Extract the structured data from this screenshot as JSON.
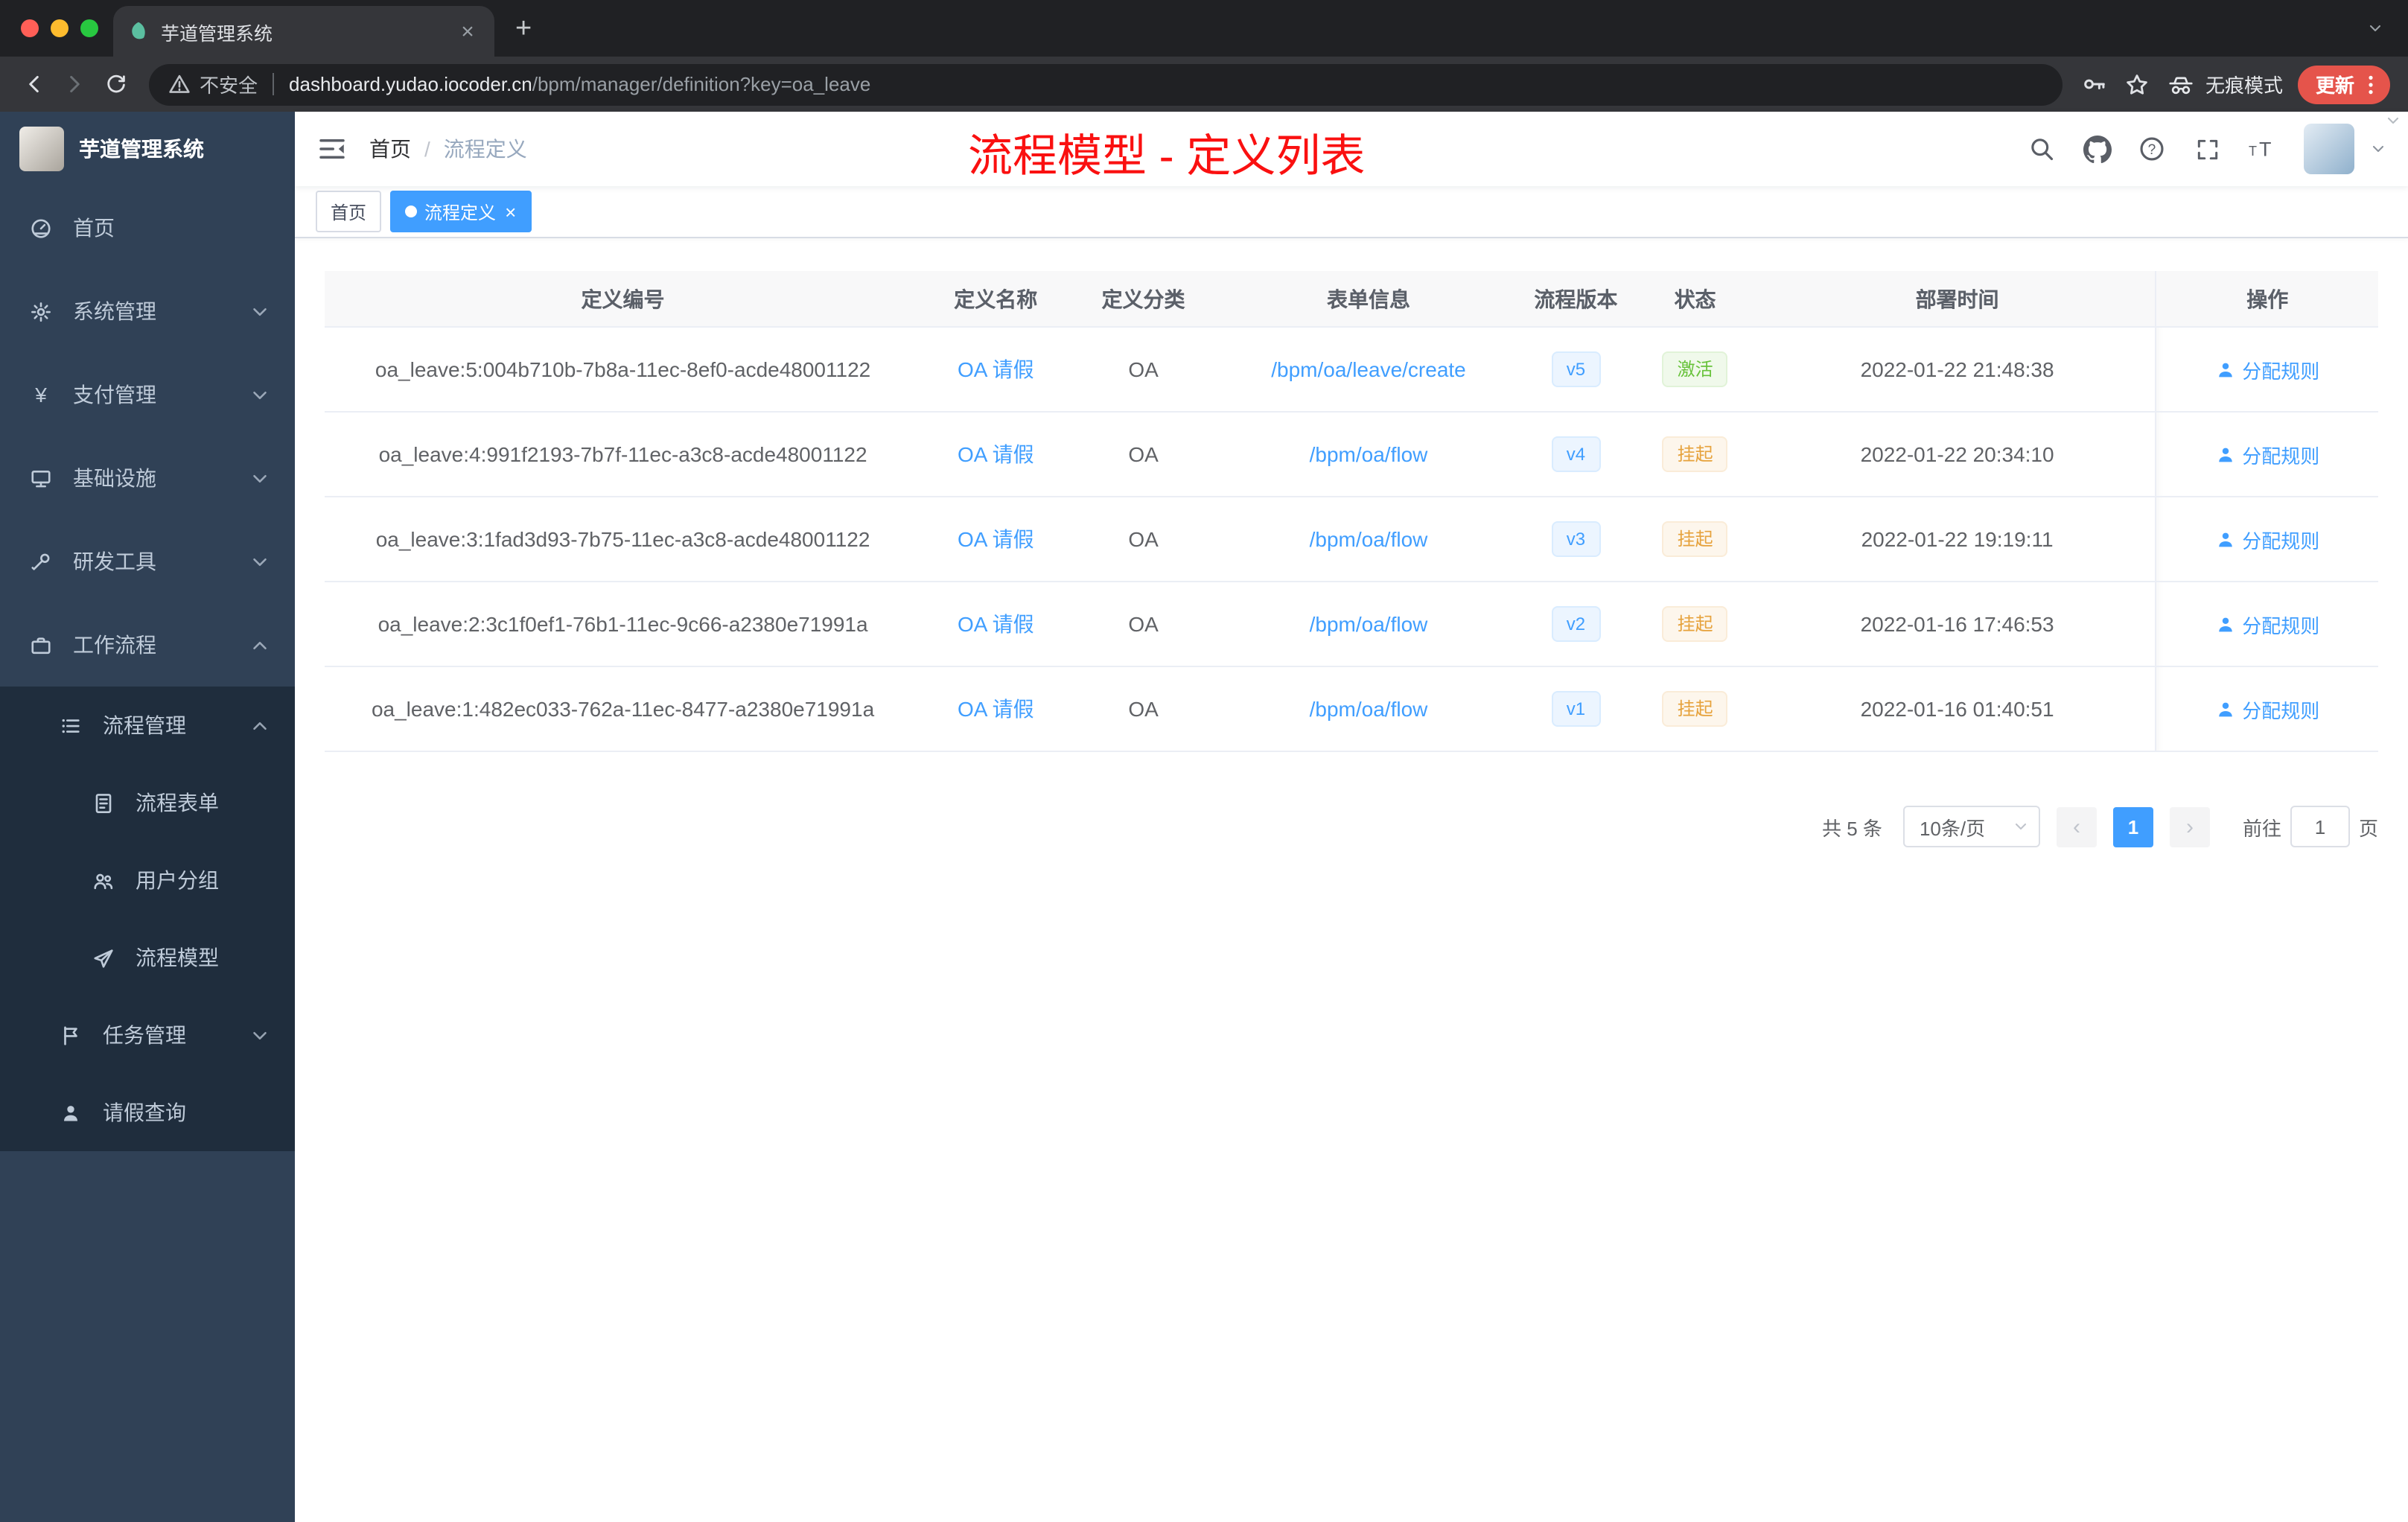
{
  "browser": {
    "tab_title": "芋道管理系统",
    "security_label": "不安全",
    "url_host": "dashboard.yudao.iocoder.cn",
    "url_path": "/bpm/manager/definition?key=oa_leave",
    "incognito_label": "无痕模式",
    "update_label": "更新"
  },
  "glyphs": {
    "close": "×",
    "plus": "+",
    "yen": "¥",
    "question": "?",
    "prev": "‹",
    "next": "›",
    "font_small": "T",
    "font_large": "T"
  },
  "sidebar": {
    "logo_title": "芋道管理系统",
    "menu": {
      "home": "首页",
      "system": "系统管理",
      "payment": "支付管理",
      "infrastructure": "基础设施",
      "devtools": "研发工具",
      "workflow": "工作流程",
      "process_mgmt": "流程管理",
      "process_form": "流程表单",
      "user_group": "用户分组",
      "process_model": "流程模型",
      "task_mgmt": "任务管理",
      "leave_query": "请假查询"
    }
  },
  "header": {
    "breadcrumb_home": "首页",
    "breadcrumb_sep": "/",
    "breadcrumb_current": "流程定义",
    "annotation": "流程模型 - 定义列表"
  },
  "tags": {
    "home": "首页",
    "active": "流程定义"
  },
  "table": {
    "columns": {
      "id": "定义编号",
      "name": "定义名称",
      "category": "定义分类",
      "form": "表单信息",
      "version": "流程版本",
      "status": "状态",
      "time": "部署时间",
      "ops": "操作"
    },
    "op_label": "分配规则",
    "rows": [
      {
        "id": "oa_leave:5:004b710b-7b8a-11ec-8ef0-acde48001122",
        "name": "OA 请假",
        "category": "OA",
        "form": "/bpm/oa/leave/create",
        "version": "v5",
        "status": "激活",
        "time": "2022-01-22 21:48:38"
      },
      {
        "id": "oa_leave:4:991f2193-7b7f-11ec-a3c8-acde48001122",
        "name": "OA 请假",
        "category": "OA",
        "form": "/bpm/oa/flow",
        "version": "v4",
        "status": "挂起",
        "time": "2022-01-22 20:34:10"
      },
      {
        "id": "oa_leave:3:1fad3d93-7b75-11ec-a3c8-acde48001122",
        "name": "OA 请假",
        "category": "OA",
        "form": "/bpm/oa/flow",
        "version": "v3",
        "status": "挂起",
        "time": "2022-01-22 19:19:11"
      },
      {
        "id": "oa_leave:2:3c1f0ef1-76b1-11ec-9c66-a2380e71991a",
        "name": "OA 请假",
        "category": "OA",
        "form": "/bpm/oa/flow",
        "version": "v2",
        "status": "挂起",
        "time": "2022-01-16 17:46:53"
      },
      {
        "id": "oa_leave:1:482ec033-762a-11ec-8477-a2380e71991a",
        "name": "OA 请假",
        "category": "OA",
        "form": "/bpm/oa/flow",
        "version": "v1",
        "status": "挂起",
        "time": "2022-01-16 01:40:51"
      }
    ]
  },
  "pagination": {
    "total": "共 5 条",
    "page_size": "10条/页",
    "current_page": "1",
    "goto_label": "前往",
    "goto_value": "1",
    "goto_unit": "页"
  },
  "colors": {
    "accent": "#409eff",
    "status_active": "#67c23a",
    "status_suspended": "#e6a23c",
    "annotation_red": "#fa1010",
    "sidebar_bg": "#304156",
    "submenu_bg": "#1f2d3d"
  }
}
